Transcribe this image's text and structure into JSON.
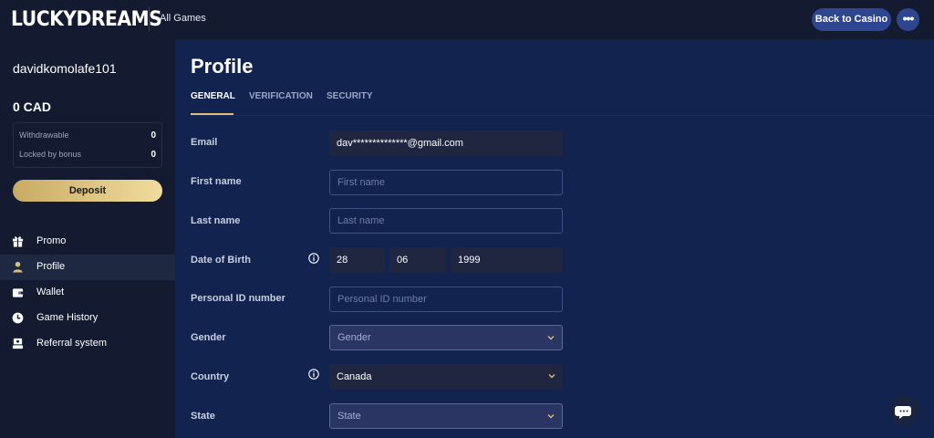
{
  "header": {
    "logo": "LUCKYDREAMS",
    "all_games": "All Games",
    "back_to_casino": "Back to Casino",
    "more_label": "•••"
  },
  "sidebar": {
    "username": "davidkomolafe101",
    "balance": "0 CAD",
    "withdrawable_label": "Withdrawable",
    "withdrawable_value": "0",
    "locked_label": "Locked by bonus",
    "locked_value": "0",
    "deposit": "Deposit",
    "items": [
      {
        "label": "Promo",
        "icon": "gift-icon"
      },
      {
        "label": "Profile",
        "icon": "user-icon",
        "active": true
      },
      {
        "label": "Wallet",
        "icon": "wallet-icon"
      },
      {
        "label": "Game History",
        "icon": "clock-icon"
      },
      {
        "label": "Referral system",
        "icon": "referral-icon"
      }
    ]
  },
  "main": {
    "title": "Profile",
    "tabs": [
      {
        "label": "GENERAL",
        "active": true
      },
      {
        "label": "VERIFICATION"
      },
      {
        "label": "SECURITY"
      }
    ],
    "form": {
      "email_label": "Email",
      "email_value": "dav**************@gmail.com",
      "first_name_label": "First name",
      "first_name_placeholder": "First name",
      "last_name_label": "Last name",
      "last_name_placeholder": "Last name",
      "dob_label": "Date of Birth",
      "dob_day": "28",
      "dob_month": "06",
      "dob_year": "1999",
      "personal_id_label": "Personal ID number",
      "personal_id_placeholder": "Personal ID number",
      "gender_label": "Gender",
      "gender_value": "Gender",
      "country_label": "Country",
      "country_value": "Canada",
      "state_label": "State",
      "state_value": "State"
    }
  },
  "colors": {
    "main_bg": "#132350",
    "sidebar_bg": "#141b30",
    "accent_gold": "#d9bf79",
    "button_blue": "#2e4590"
  }
}
